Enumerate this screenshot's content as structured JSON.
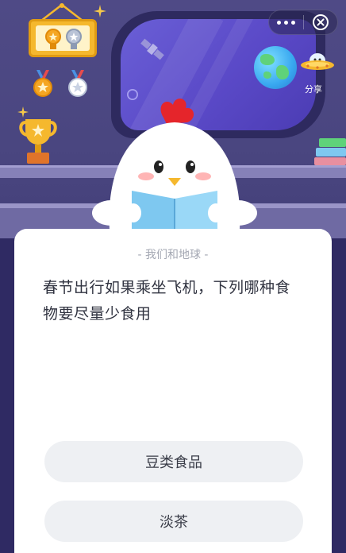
{
  "header": {
    "share_label": "分享",
    "more_icon": "more-dots-icon",
    "close_icon": "close-circle-icon"
  },
  "scene": {
    "icons": [
      "plaque-icon",
      "medal-icon",
      "trophy-icon",
      "satellite-icon",
      "earth-icon",
      "ufo-icon",
      "books-icon",
      "chick-mascot-icon"
    ],
    "accent_colors": {
      "wall": "#4a4680",
      "window_glass": "#5a49c7",
      "gold": "#f5b82e",
      "mascot_comb": "#e5252b",
      "book": "#7ec8f0"
    }
  },
  "quiz": {
    "category": "- 我们和地球 -",
    "question": "春节出行如果乘坐飞机，下列哪种食物要尽量少食用",
    "options": [
      {
        "label": "豆类食品"
      },
      {
        "label": "淡茶"
      }
    ]
  }
}
